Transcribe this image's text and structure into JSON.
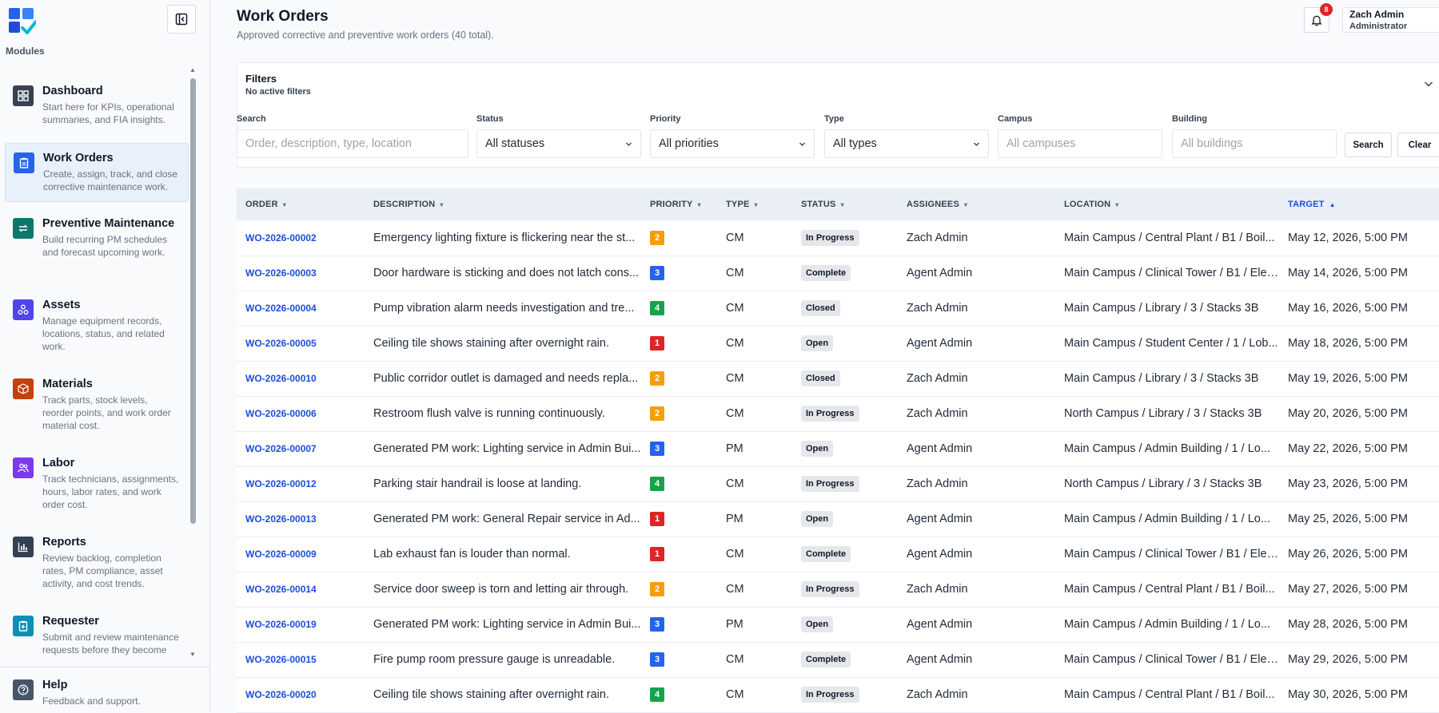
{
  "colors": {
    "accent": "#1d4ed8",
    "priority": {
      "1": "#dc2626",
      "2": "#f59e0b",
      "3": "#2563eb",
      "4": "#16a34a"
    }
  },
  "sidebar": {
    "modules_label": "Modules",
    "items": [
      {
        "title": "Dashboard",
        "desc": "Start here for KPIs, operational summaries, and FIA insights.",
        "icon": "dashboard-icon",
        "color": "#374151"
      },
      {
        "title": "Work Orders",
        "desc": "Create, assign, track, and close corrective maintenance work.",
        "icon": "clipboard-icon",
        "color": "#2563eb",
        "active": true
      },
      {
        "title": "Preventive Maintenance",
        "desc": "Build recurring PM schedules and forecast upcoming work.",
        "icon": "repeat-icon",
        "color": "#0f766e"
      },
      {
        "title": "Assets",
        "desc": "Manage equipment records, locations, status, and related work.",
        "icon": "assets-icon",
        "color": "#4f46e5"
      },
      {
        "title": "Materials",
        "desc": "Track parts, stock levels, reorder points, and work order material cost.",
        "icon": "box-icon",
        "color": "#c2410c"
      },
      {
        "title": "Labor",
        "desc": "Track technicians, assignments, hours, labor rates, and work order cost.",
        "icon": "users-icon",
        "color": "#7c3aed"
      },
      {
        "title": "Reports",
        "desc": "Review backlog, completion rates, PM compliance, asset activity, and cost trends.",
        "icon": "bar-chart-icon",
        "color": "#334155"
      },
      {
        "title": "Requester",
        "desc": "Submit and review maintenance requests before they become",
        "icon": "request-icon",
        "color": "#0891b2"
      },
      {
        "title": "Help",
        "desc": "Feedback and support.",
        "icon": "help-icon",
        "color": "#475569"
      }
    ]
  },
  "header": {
    "title": "Work Orders",
    "subtitle": "Approved corrective and preventive work orders (40 total).",
    "notification_count": "8",
    "user_name": "Zach Admin",
    "user_role": "Administrator"
  },
  "filters": {
    "title": "Filters",
    "status": "No active filters",
    "search_label": "Search",
    "search_placeholder": "Order, description, type, location",
    "status_label": "Status",
    "status_value": "All statuses",
    "priority_label": "Priority",
    "priority_value": "All priorities",
    "type_label": "Type",
    "type_value": "All types",
    "campus_label": "Campus",
    "campus_placeholder": "All campuses",
    "building_label": "Building",
    "building_placeholder": "All buildings",
    "search_button": "Search",
    "clear_button": "Clear"
  },
  "table": {
    "columns": [
      "ORDER",
      "DESCRIPTION",
      "PRIORITY",
      "TYPE",
      "STATUS",
      "ASSIGNEES",
      "LOCATION",
      "TARGET"
    ],
    "rows": [
      {
        "order": "WO-2026-00002",
        "description": "Emergency lighting fixture is flickering near the st...",
        "priority": "2",
        "type": "CM",
        "status": "In Progress",
        "assignee": "Zach Admin",
        "location": "Main Campus / Central Plant / B1 / Boil...",
        "target": "May 12, 2026, 5:00 PM"
      },
      {
        "order": "WO-2026-00003",
        "description": "Door hardware is sticking and does not latch cons...",
        "priority": "3",
        "type": "CM",
        "status": "Complete",
        "assignee": "Agent Admin",
        "location": "Main Campus / Clinical Tower / B1 / Elec...",
        "target": "May 14, 2026, 5:00 PM"
      },
      {
        "order": "WO-2026-00004",
        "description": "Pump vibration alarm needs investigation and tre...",
        "priority": "4",
        "type": "CM",
        "status": "Closed",
        "assignee": "Zach Admin",
        "location": "Main Campus / Library / 3 / Stacks 3B",
        "target": "May 16, 2026, 5:00 PM"
      },
      {
        "order": "WO-2026-00005",
        "description": "Ceiling tile shows staining after overnight rain.",
        "priority": "1",
        "type": "CM",
        "status": "Open",
        "assignee": "Agent Admin",
        "location": "Main Campus / Student Center / 1 / Lob...",
        "target": "May 18, 2026, 5:00 PM"
      },
      {
        "order": "WO-2026-00010",
        "description": "Public corridor outlet is damaged and needs repla...",
        "priority": "2",
        "type": "CM",
        "status": "Closed",
        "assignee": "Zach Admin",
        "location": "Main Campus / Library / 3 / Stacks 3B",
        "target": "May 19, 2026, 5:00 PM"
      },
      {
        "order": "WO-2026-00006",
        "description": "Restroom flush valve is running continuously.",
        "priority": "2",
        "type": "CM",
        "status": "In Progress",
        "assignee": "Zach Admin",
        "location": "North Campus / Library / 3 / Stacks 3B",
        "target": "May 20, 2026, 5:00 PM"
      },
      {
        "order": "WO-2026-00007",
        "description": "Generated PM work: Lighting service in Admin Bui...",
        "priority": "3",
        "type": "PM",
        "status": "Open",
        "assignee": "Agent Admin",
        "location": "Main Campus / Admin Building / 1 / Lo...",
        "target": "May 22, 2026, 5:00 PM"
      },
      {
        "order": "WO-2026-00012",
        "description": "Parking stair handrail is loose at landing.",
        "priority": "4",
        "type": "CM",
        "status": "In Progress",
        "assignee": "Zach Admin",
        "location": "North Campus / Library / 3 / Stacks 3B",
        "target": "May 23, 2026, 5:00 PM"
      },
      {
        "order": "WO-2026-00013",
        "description": "Generated PM work: General Repair service in Ad...",
        "priority": "1",
        "type": "PM",
        "status": "Open",
        "assignee": "Agent Admin",
        "location": "Main Campus / Admin Building / 1 / Lo...",
        "target": "May 25, 2026, 5:00 PM"
      },
      {
        "order": "WO-2026-00009",
        "description": "Lab exhaust fan is louder than normal.",
        "priority": "1",
        "type": "CM",
        "status": "Complete",
        "assignee": "Agent Admin",
        "location": "Main Campus / Clinical Tower / B1 / Elec...",
        "target": "May 26, 2026, 5:00 PM"
      },
      {
        "order": "WO-2026-00014",
        "description": "Service door sweep is torn and letting air through.",
        "priority": "2",
        "type": "CM",
        "status": "In Progress",
        "assignee": "Zach Admin",
        "location": "Main Campus / Central Plant / B1 / Boil...",
        "target": "May 27, 2026, 5:00 PM"
      },
      {
        "order": "WO-2026-00019",
        "description": "Generated PM work: Lighting service in Admin Bui...",
        "priority": "3",
        "type": "PM",
        "status": "Open",
        "assignee": "Agent Admin",
        "location": "Main Campus / Admin Building / 1 / Lo...",
        "target": "May 28, 2026, 5:00 PM"
      },
      {
        "order": "WO-2026-00015",
        "description": "Fire pump room pressure gauge is unreadable.",
        "priority": "3",
        "type": "CM",
        "status": "Complete",
        "assignee": "Agent Admin",
        "location": "Main Campus / Clinical Tower / B1 / Elec...",
        "target": "May 29, 2026, 5:00 PM"
      },
      {
        "order": "WO-2026-00020",
        "description": "Ceiling tile shows staining after overnight rain.",
        "priority": "4",
        "type": "CM",
        "status": "In Progress",
        "assignee": "Zach Admin",
        "location": "Main Campus / Central Plant / B1 / Boil...",
        "target": "May 30, 2026, 5:00 PM"
      }
    ]
  }
}
